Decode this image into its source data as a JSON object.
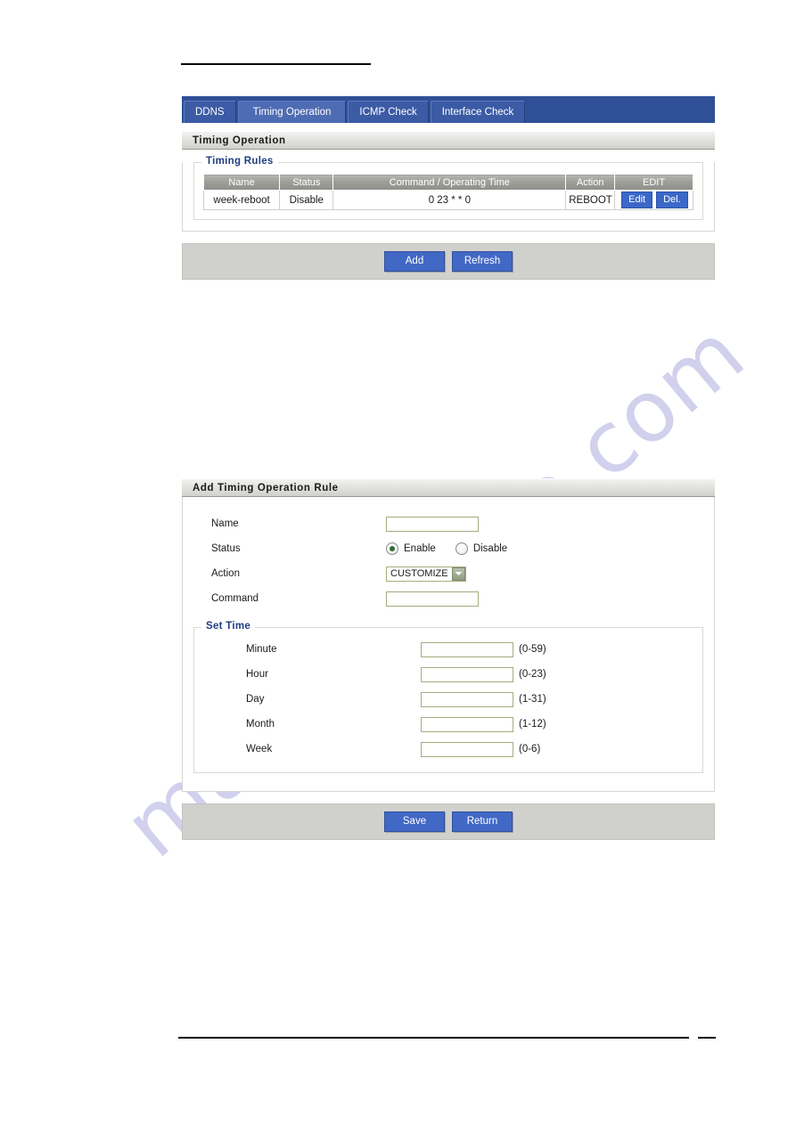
{
  "watermark": {
    "text": "manualshive.com"
  },
  "colors": {
    "tabbar_bg": "#2f4f96",
    "tab_active_bg": "#4e6cb3",
    "tab_inactive_bg": "#3b5ba5",
    "button_blue": "#4268c6",
    "legend_blue": "#1f3c80",
    "table_header_gray": "#9d9d98",
    "buttonbar_gray": "#d0d0cd",
    "input_border": "#aaa97e"
  },
  "tabs": [
    {
      "label": "DDNS",
      "active": false
    },
    {
      "label": "Timing Operation",
      "active": true
    },
    {
      "label": "ICMP Check",
      "active": false
    },
    {
      "label": "Interface Check",
      "active": false
    }
  ],
  "list_section": {
    "title": "Timing Operation",
    "group_legend": "Timing Rules",
    "table": {
      "headers": [
        "Name",
        "Status",
        "Command / Operating Time",
        "Action",
        "EDIT"
      ],
      "rows": [
        {
          "name": "week-reboot",
          "status": "Disable",
          "command": "0 23 * * 0",
          "action": "REBOOT",
          "edit_label": "Edit",
          "delete_label": "Del."
        }
      ]
    },
    "buttons": [
      {
        "label": "Add"
      },
      {
        "label": "Refresh"
      }
    ]
  },
  "form_section": {
    "title": "Add Timing Operation Rule",
    "fields": {
      "name": {
        "label": "Name",
        "value": "",
        "placeholder": ""
      },
      "status": {
        "label": "Status",
        "options": [
          {
            "label": "Enable",
            "selected": true
          },
          {
            "label": "Disable",
            "selected": false
          }
        ]
      },
      "action": {
        "label": "Action",
        "selected": "CUSTOMIZE"
      },
      "command": {
        "label": "Command",
        "value": "",
        "placeholder": ""
      }
    },
    "set_time": {
      "legend": "Set Time",
      "rows": [
        {
          "label": "Minute",
          "value": "",
          "range": "(0-59)"
        },
        {
          "label": "Hour",
          "value": "",
          "range": "(0-23)"
        },
        {
          "label": "Day",
          "value": "",
          "range": "(1-31)"
        },
        {
          "label": "Month",
          "value": "",
          "range": "(1-12)"
        },
        {
          "label": "Week",
          "value": "",
          "range": "(0-6)"
        }
      ]
    },
    "buttons": [
      {
        "label": "Save"
      },
      {
        "label": "Return"
      }
    ]
  }
}
